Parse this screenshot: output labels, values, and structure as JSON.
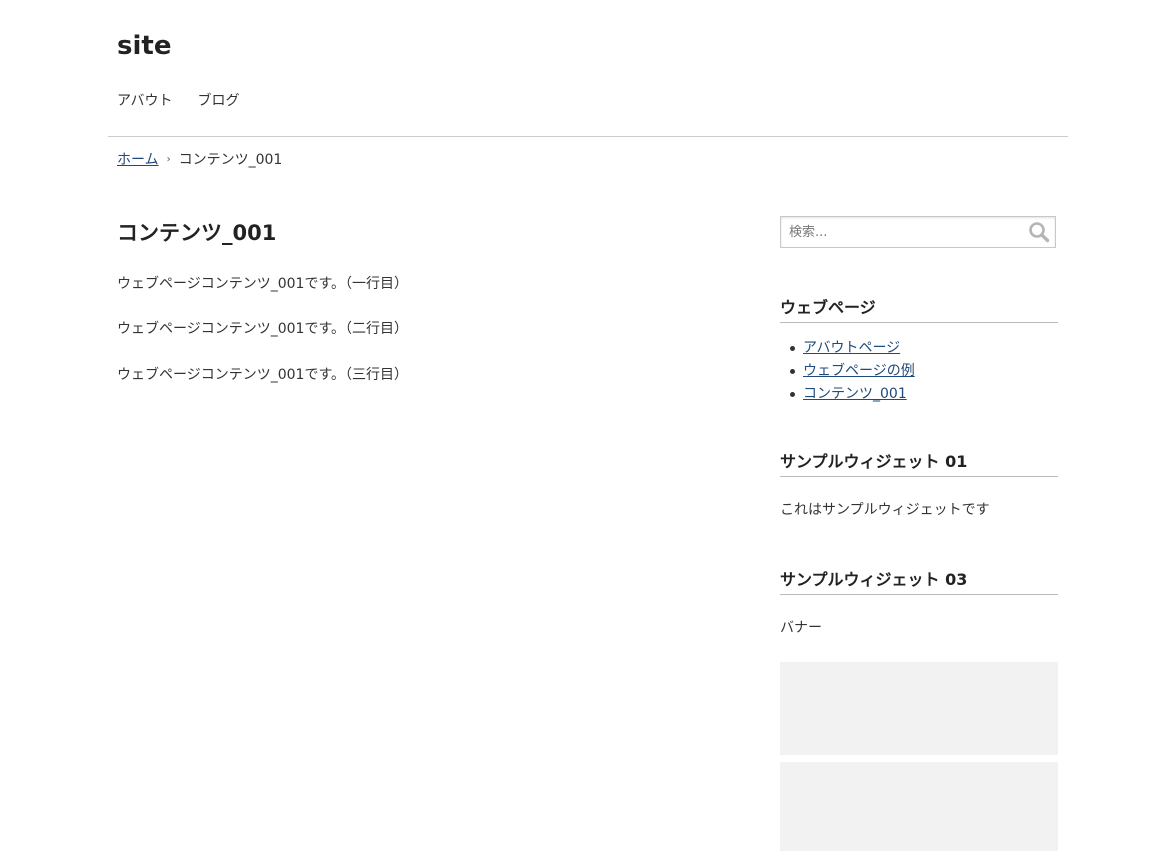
{
  "header": {
    "site_title": "site",
    "nav": [
      {
        "label": "アバウト"
      },
      {
        "label": "ブログ"
      }
    ]
  },
  "breadcrumb": {
    "home": "ホーム",
    "separator": "›",
    "current": "コンテンツ_001"
  },
  "main": {
    "title": "コンテンツ_001",
    "paragraphs": [
      "ウェブページコンテンツ_001です。（一行目）",
      "ウェブページコンテンツ_001です。（二行目）",
      "ウェブページコンテンツ_001です。（三行目）"
    ]
  },
  "sidebar": {
    "search": {
      "placeholder": "検索...",
      "icon": "search-icon"
    },
    "pages_widget": {
      "title": "ウェブページ",
      "items": [
        {
          "label": "アバウトページ"
        },
        {
          "label": "ウェブページの例"
        },
        {
          "label": "コンテンツ_001"
        }
      ]
    },
    "widget_01": {
      "title": "サンプルウィジェット 01",
      "text": "これはサンプルウィジェットです"
    },
    "widget_03": {
      "title": "サンプルウィジェット 03",
      "text": "バナー"
    }
  },
  "colors": {
    "link": "#1f4a7a",
    "text": "#333333",
    "banner_bg": "#f2f2f2"
  }
}
